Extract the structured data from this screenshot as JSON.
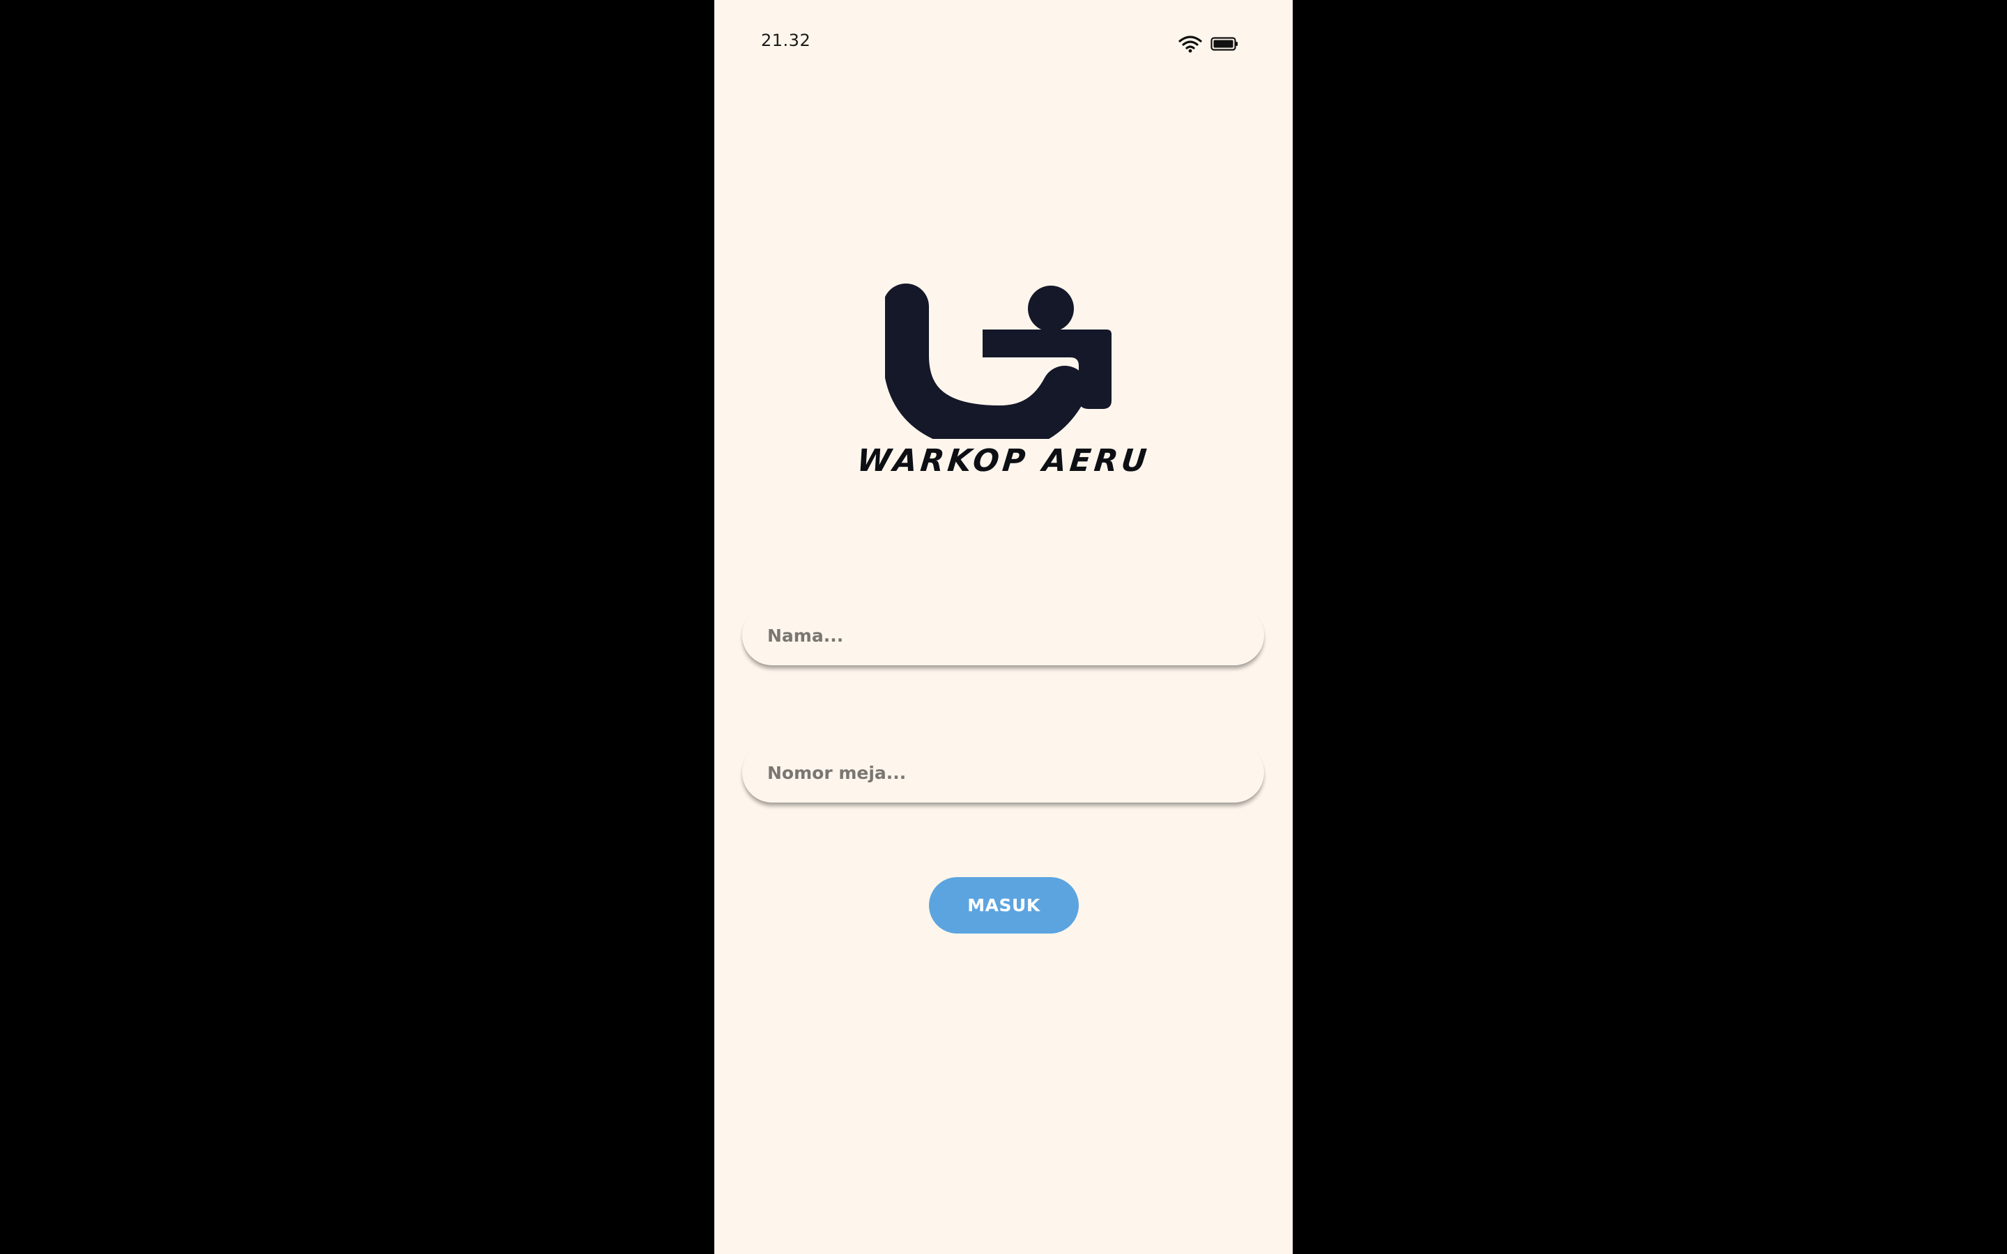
{
  "status_bar": {
    "time": "21.32",
    "icons": [
      "wifi-icon",
      "battery-icon"
    ]
  },
  "logo": {
    "brand_name": "WARKOP AERU",
    "mark_color": "#141829"
  },
  "form": {
    "name_placeholder": "Nama...",
    "table_placeholder": "Nomor meja...",
    "submit_label": "MASUK"
  },
  "colors": {
    "background": "#FEF6EC",
    "accent": "#5BA4E0",
    "backdrop": "#000000"
  }
}
